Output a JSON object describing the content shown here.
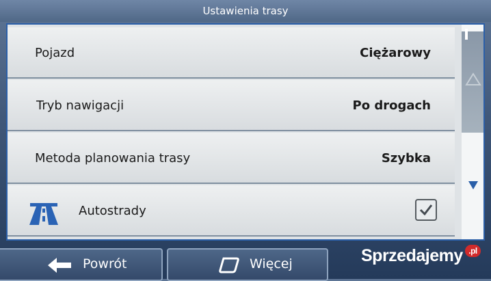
{
  "header": {
    "title": "Ustawienia trasy"
  },
  "settings": [
    {
      "label": "Pojazd",
      "value": "Ciężarowy"
    },
    {
      "label": "Tryb nawigacji",
      "value": "Po drogach"
    },
    {
      "label": "Metoda planowania trasy",
      "value": "Szybka"
    }
  ],
  "toggles": [
    {
      "label": "Autostrady",
      "checked": true,
      "icon": "highway-icon"
    }
  ],
  "footer": {
    "back_label": "Powrót",
    "more_label": "Więcej"
  },
  "watermark": {
    "text": "Sprzedajemy",
    "suffix": ".pl"
  }
}
